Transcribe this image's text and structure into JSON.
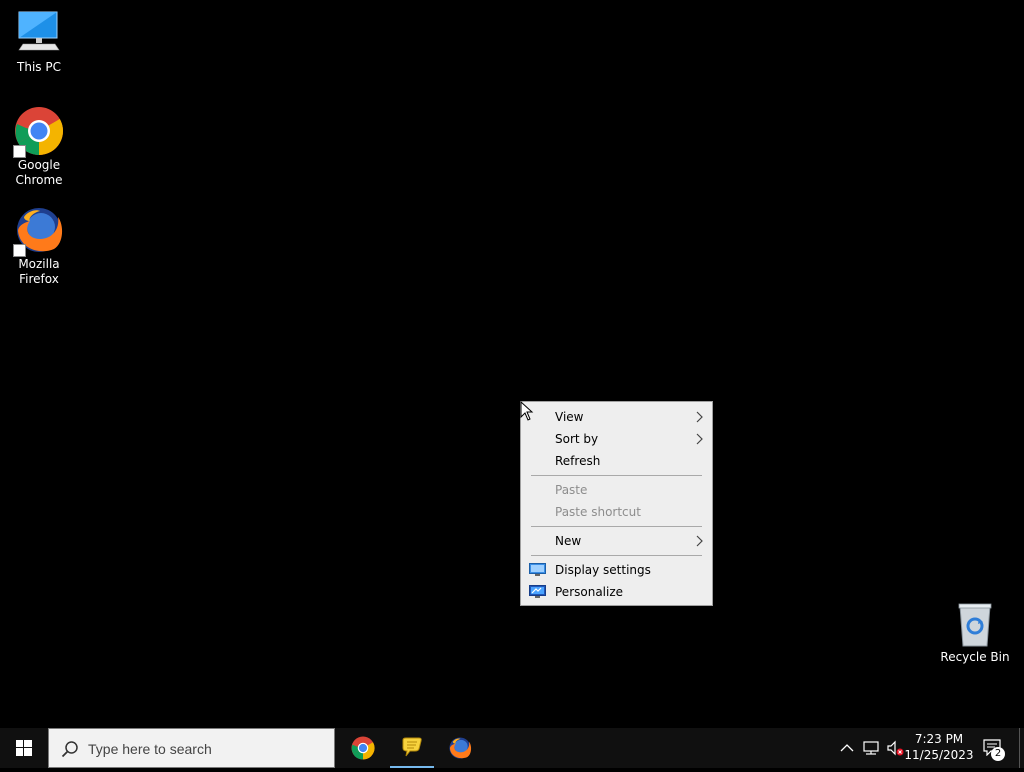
{
  "desktop": {
    "icons": [
      {
        "label_line1": "This PC",
        "label_line2": ""
      },
      {
        "label_line1": "Google",
        "label_line2": "Chrome"
      },
      {
        "label_line1": "Mozilla",
        "label_line2": "Firefox"
      },
      {
        "label_line1": "Recycle Bin",
        "label_line2": ""
      }
    ]
  },
  "context_menu": {
    "items": [
      {
        "label": "View",
        "submenu": true,
        "enabled": true
      },
      {
        "label": "Sort by",
        "submenu": true,
        "enabled": true
      },
      {
        "label": "Refresh",
        "submenu": false,
        "enabled": true
      },
      {
        "label": "Paste",
        "submenu": false,
        "enabled": false
      },
      {
        "label": "Paste shortcut",
        "submenu": false,
        "enabled": false
      },
      {
        "label": "New",
        "submenu": true,
        "enabled": true
      },
      {
        "label": "Display settings",
        "submenu": false,
        "enabled": true,
        "icon": "display-icon"
      },
      {
        "label": "Personalize",
        "submenu": false,
        "enabled": true,
        "icon": "personalize-icon"
      }
    ]
  },
  "taskbar": {
    "search_placeholder": "Type here to search",
    "apps": [
      {
        "name": "chrome-icon",
        "active": false
      },
      {
        "name": "chat-icon",
        "active": true
      },
      {
        "name": "firefox-icon",
        "active": false
      }
    ],
    "clock": {
      "time": "7:23 PM",
      "date": "11/25/2023"
    },
    "notification_count": "2"
  },
  "colors": {
    "desktop_bg": "#000000",
    "taskbar_bg": "#101010",
    "menu_bg": "#eeeeee",
    "disabled_text": "#8d8d8d",
    "accent": "#76b9ed"
  }
}
